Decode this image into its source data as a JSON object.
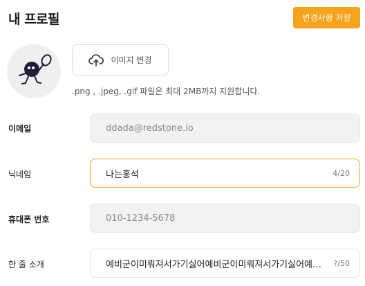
{
  "header": {
    "title": "내 프로필",
    "save_label": "변경사항 저장"
  },
  "avatar": {
    "icon": "racket-character-icon"
  },
  "image_change": {
    "label": "이미지 변경",
    "icon": "cloud-upload-icon"
  },
  "hint": ".png , .jpeg, .gif 파일은 최대 2MB까지 지원합니다.",
  "fields": {
    "email": {
      "label": "이메일",
      "value": "ddada@redstone.io"
    },
    "nickname": {
      "label": "닉네임",
      "value": "나는홍석",
      "counter": "4/20"
    },
    "phone": {
      "label": "휴대폰 번호",
      "value": "010-1234-5678"
    },
    "intro": {
      "label": "한 줄 소개",
      "value": "예비군이미뤄져서가기싫어예비군이미뤄져서가기싫어예비군이미뤄져서가기싫어",
      "counter": "?/50"
    }
  },
  "colors": {
    "accent": "#f5a31a",
    "disabled_bg": "#f2f2f2"
  }
}
